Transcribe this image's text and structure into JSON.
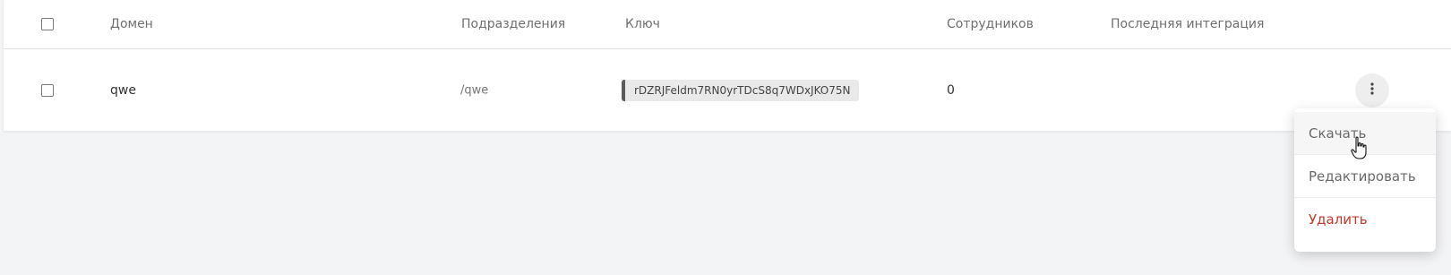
{
  "table": {
    "columns": {
      "domain": "Домен",
      "divisions": "Подразделения",
      "key": "Ключ",
      "employees": "Сотрудников",
      "last_integration": "Последняя интеграция"
    },
    "rows": [
      {
        "domain": "qwe",
        "divisions": "/qwe",
        "key": "rDZRJFeldm7RN0yrTDcS8q7WDxJKO75N",
        "employees": "0",
        "last_integration": ""
      }
    ]
  },
  "menu": {
    "items": [
      {
        "label": "Скачать"
      },
      {
        "label": "Редактировать"
      },
      {
        "label": "Удалить"
      }
    ]
  },
  "colors": {
    "page_bg": "#f3f4f6",
    "danger": "#c0392b",
    "key_accent": "#5b5b5b"
  },
  "icons": {
    "row_actions": "more-vertical-icon",
    "cursor": "hand-pointer-icon"
  }
}
